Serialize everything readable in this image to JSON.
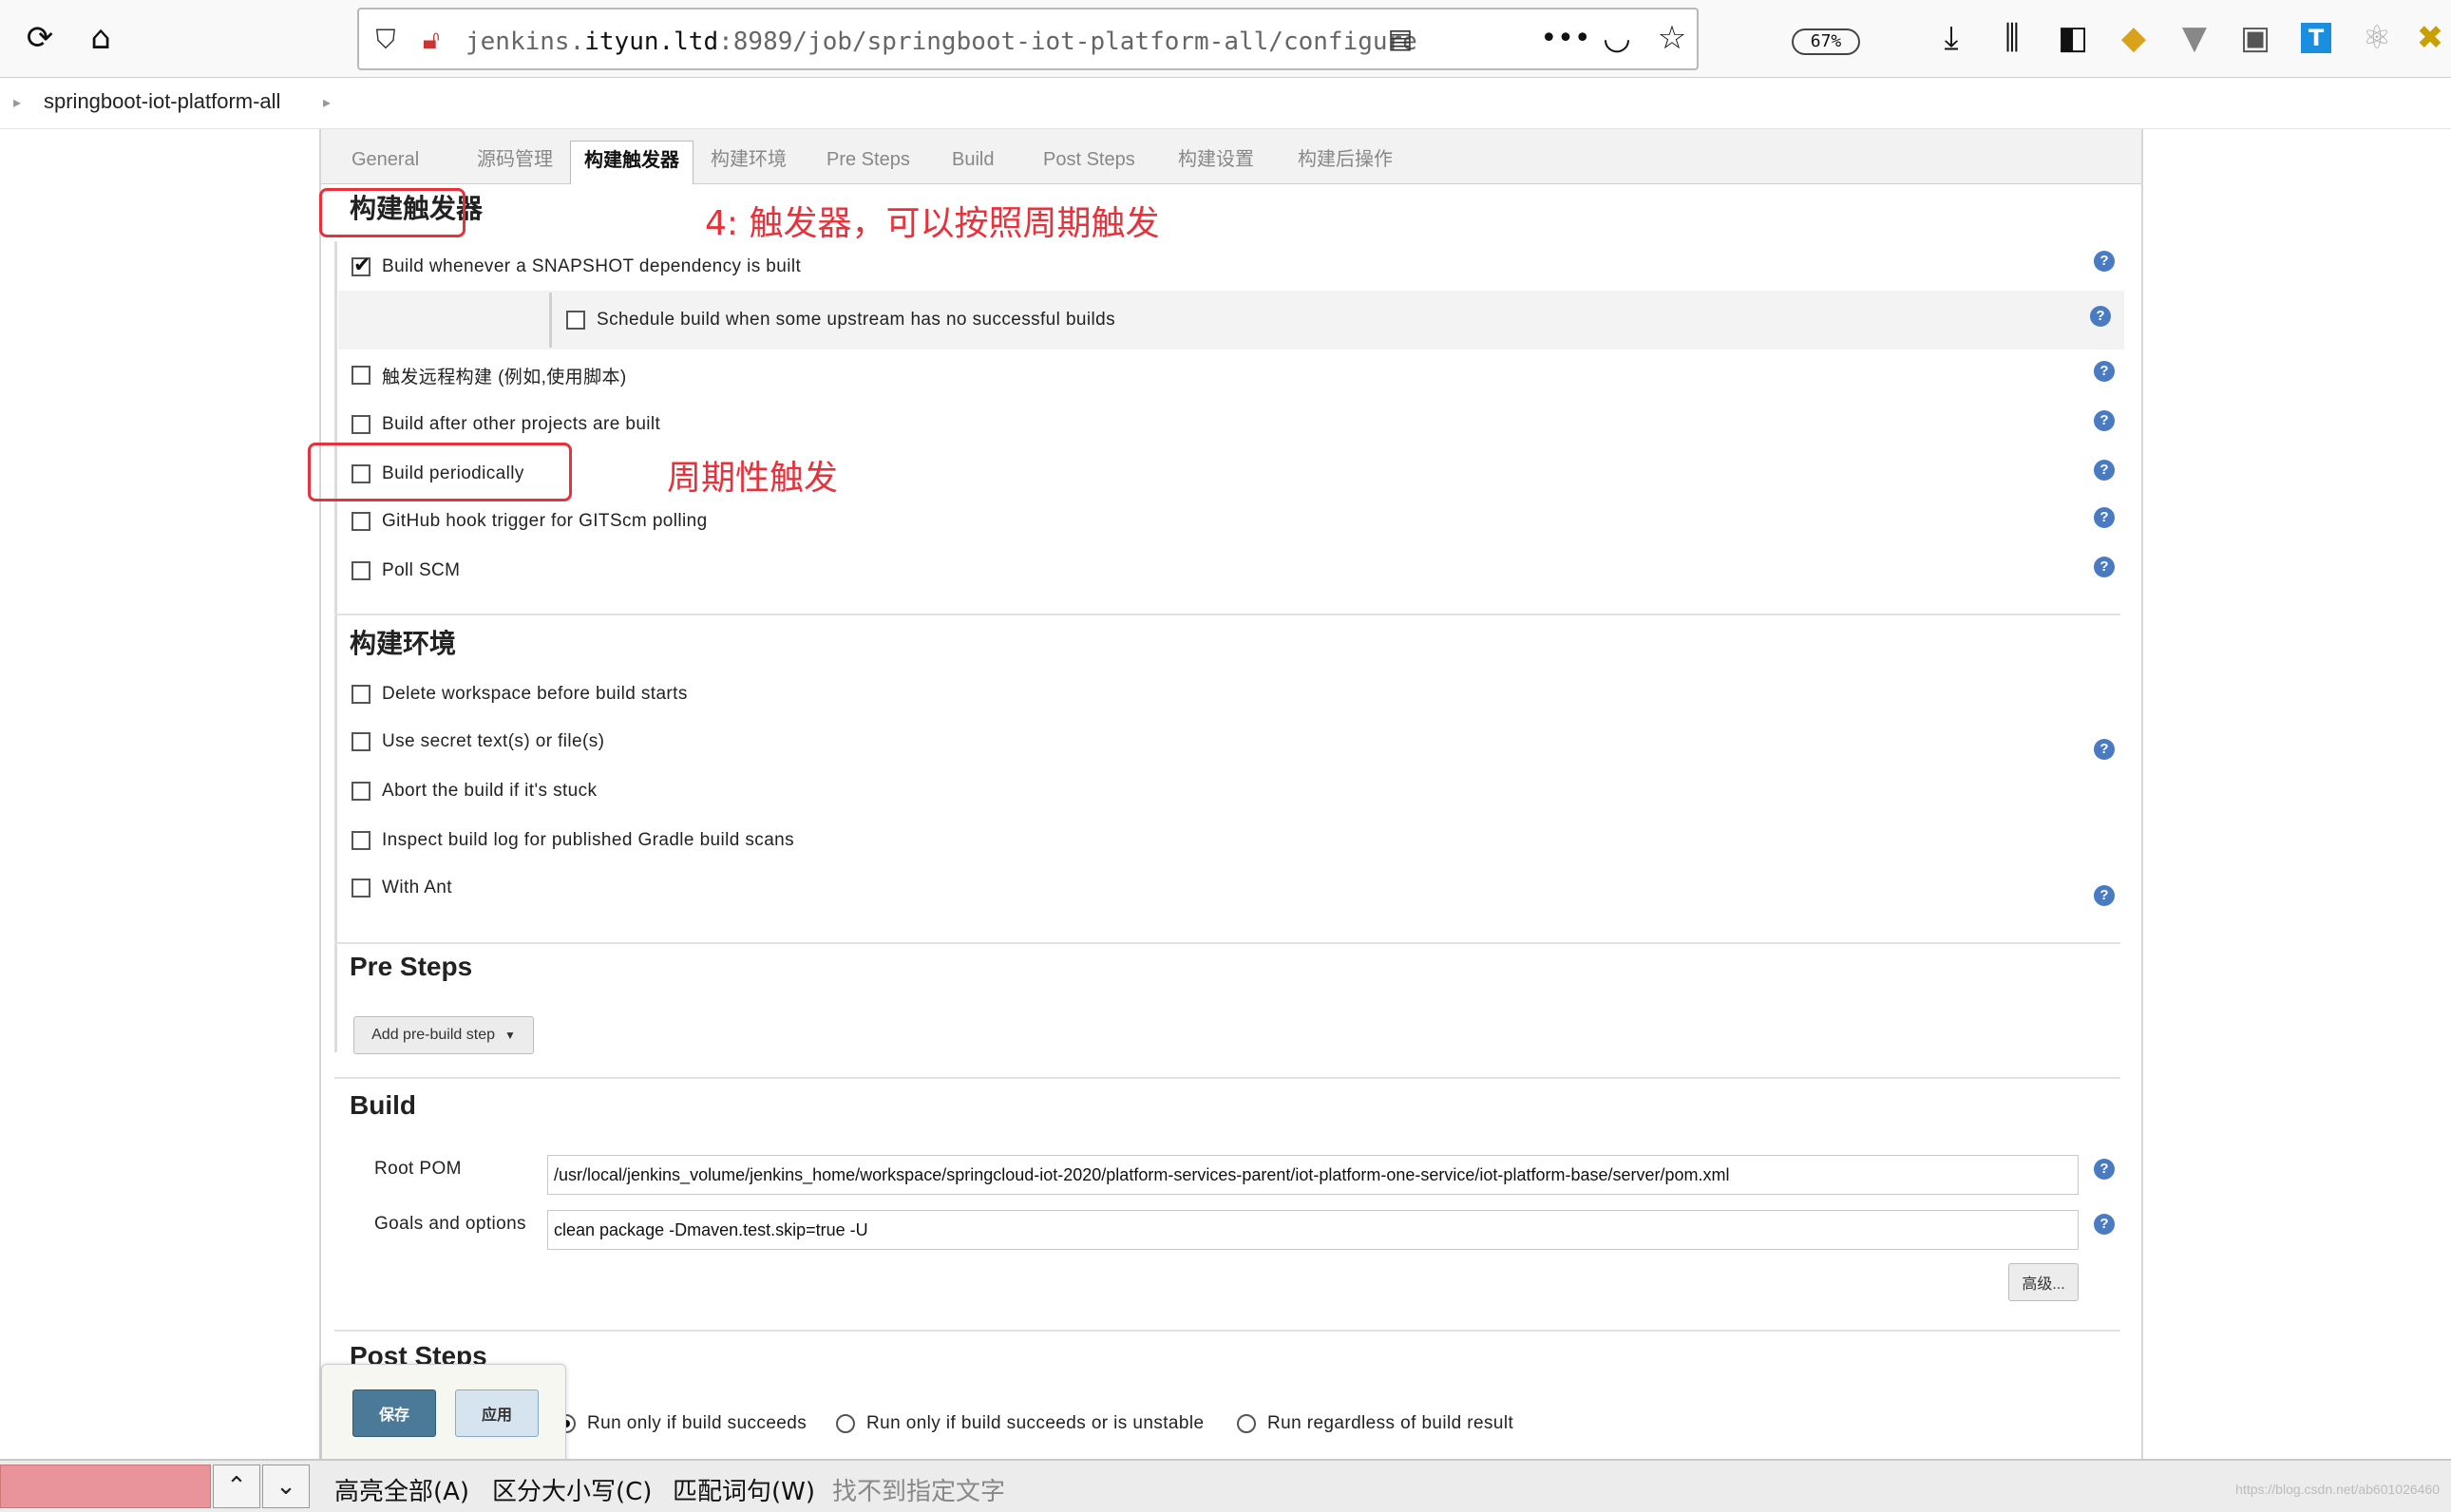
{
  "browser": {
    "url_prefix": "jenkins.",
    "url_host": "ityun.ltd",
    "url_rest": ":8989/job/springboot-iot-platform-all/configure",
    "zoom": "67%"
  },
  "breadcrumb": {
    "job": "springboot-iot-platform-all"
  },
  "tabs": [
    "General",
    "源码管理",
    "构建触发器",
    "构建环境",
    "Pre Steps",
    "Build",
    "Post Steps",
    "构建设置",
    "构建后操作"
  ],
  "triggers": {
    "title": "构建触发器",
    "items": [
      {
        "label": "Build whenever a SNAPSHOT dependency is built",
        "checked": true
      },
      {
        "label": "Schedule build when some upstream has no successful builds",
        "checked": false
      },
      {
        "label": "触发远程构建 (例如,使用脚本)",
        "checked": false
      },
      {
        "label": "Build after other projects are built",
        "checked": false
      },
      {
        "label": "Build periodically",
        "checked": false
      },
      {
        "label": "GitHub hook trigger for GITScm polling",
        "checked": false
      },
      {
        "label": "Poll SCM",
        "checked": false
      }
    ]
  },
  "annotations": {
    "trigger_note": "4: 触发器，可以按照周期触发",
    "periodic_note": "周期性触发"
  },
  "build_env": {
    "title": "构建环境",
    "items": [
      {
        "label": "Delete workspace before build starts",
        "checked": false
      },
      {
        "label": "Use secret text(s) or file(s)",
        "checked": false
      },
      {
        "label": "Abort the build if it's stuck",
        "checked": false
      },
      {
        "label": "Inspect build log for published Gradle build scans",
        "checked": false
      },
      {
        "label": "With Ant",
        "checked": false
      }
    ]
  },
  "pre_steps": {
    "title": "Pre Steps",
    "add_button": "Add pre-build step"
  },
  "build": {
    "title": "Build",
    "root_pom_label": "Root POM",
    "root_pom_value": "/usr/local/jenkins_volume/jenkins_home/workspace/springcloud-iot-2020/platform-services-parent/iot-platform-one-service/iot-platform-base/server/pom.xml",
    "goals_label": "Goals and options",
    "goals_value": "clean package -Dmaven.test.skip=true -U",
    "advanced_button": "高级..."
  },
  "post_steps": {
    "title": "Post Steps",
    "options": [
      {
        "label": "Run only if build succeeds",
        "selected": true
      },
      {
        "label": "Run only if build succeeds or is unstable",
        "selected": false
      },
      {
        "label": "Run regardless of build result",
        "selected": false
      }
    ]
  },
  "savebar": {
    "save": "保存",
    "apply": "应用"
  },
  "findbar": {
    "highlight_all": "高亮全部(A)",
    "match_case": "区分大小写(C)",
    "whole_words": "匹配词句(W)",
    "status": "找不到指定文字",
    "watermark": "https://blog.csdn.net/ab601026460"
  }
}
